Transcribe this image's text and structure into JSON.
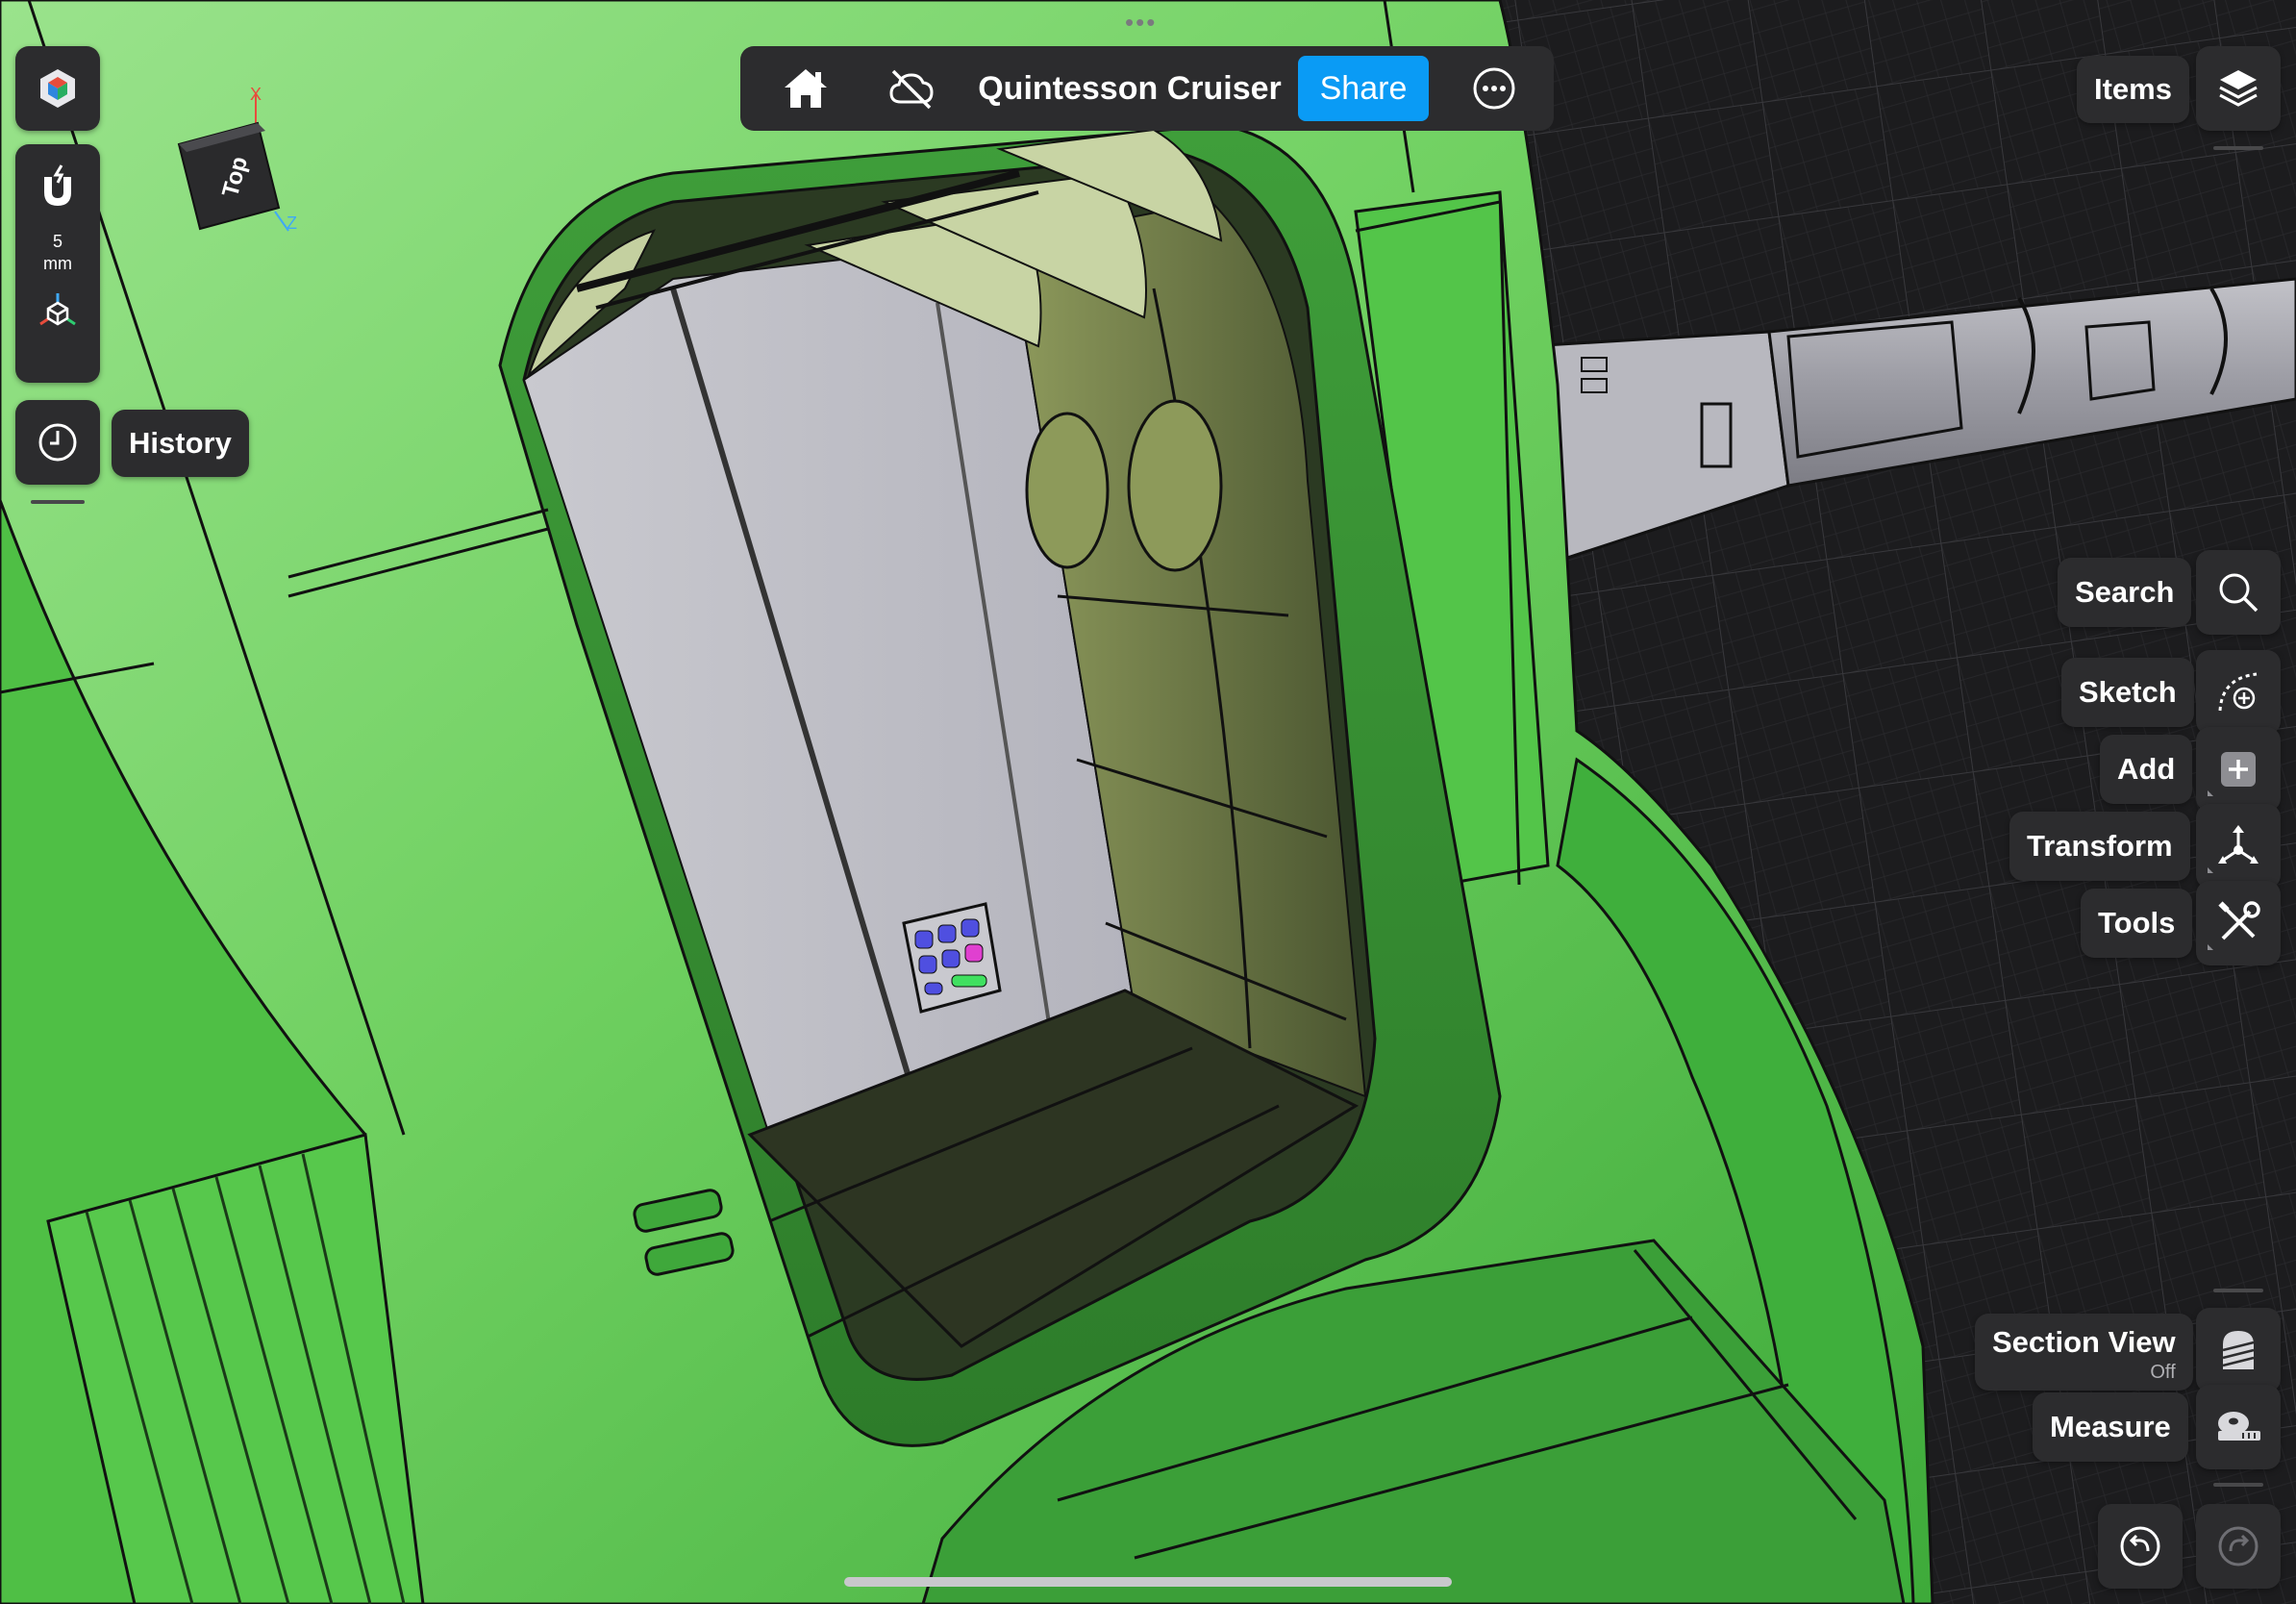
{
  "top_bar": {
    "title": "Quintesson Cruiser",
    "share_label": "Share"
  },
  "left_toolbar": {
    "snap_value": "5",
    "snap_unit": "mm",
    "history_label": "History"
  },
  "view_cube": {
    "face_label": "Top",
    "axis_x": "X",
    "axis_z": "Z"
  },
  "right_toolbar": {
    "items_label": "Items",
    "search_label": "Search",
    "sketch_label": "Sketch",
    "add_label": "Add",
    "transform_label": "Transform",
    "tools_label": "Tools",
    "section_view_label": "Section View",
    "section_view_status": "Off",
    "measure_label": "Measure"
  },
  "icons": {
    "app": "app-cube-icon",
    "snap": "magnet-icon",
    "transform_space": "cube-axes-icon",
    "history": "clock-icon",
    "home": "home-icon",
    "cloud": "cloud-off-icon",
    "more": "ellipsis-icon",
    "items": "layers-icon",
    "search": "magnifier-icon",
    "sketch": "sketch-arc-icon",
    "add": "plus-square-icon",
    "transform": "move-arrows-icon",
    "tools": "wrench-screwdriver-icon",
    "section": "section-view-icon",
    "measure": "tape-measure-icon",
    "undo": "undo-icon",
    "redo": "redo-icon"
  },
  "colors": {
    "model_green": "#4cc04a",
    "model_green_light": "#8edc7e",
    "accent_blue": "#0a9bf5",
    "panel": "#2c2c2e",
    "grid_bg": "#1c1c1e"
  }
}
